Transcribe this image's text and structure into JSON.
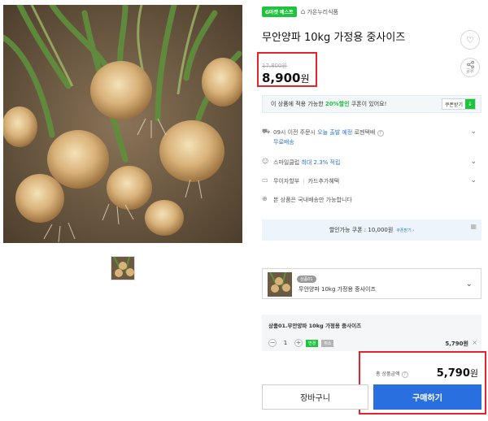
{
  "badges": {
    "seller_badge": "G마켓 베스트",
    "seller_name": "가온누리식품"
  },
  "product": {
    "title": "무안양파 10kg 가정용 중사이즈",
    "original_price": "17,800원",
    "price_number": "8,900",
    "price_unit": "원"
  },
  "actions": {
    "share_label": "공유"
  },
  "coupon_bar": {
    "text_before": "이 상품에 적용 가능한 ",
    "highlight": "20%할인",
    "text_after": " 쿠폰이 있어요!",
    "button_label": "쿠폰받기"
  },
  "info": {
    "delivery_time": "09시 이전 주문시",
    "delivery_highlight": "오늘 출발 예정",
    "delivery_extra": "로젠택배",
    "free_shipping": "무료배송",
    "smile_prefix": "스마일클럽",
    "smile_highlight": "최대 2.3% 적립",
    "installment": "무이자할부",
    "card_benefit": "카드추가혜택",
    "domestic": "본 상품은 국내배송만 가능합니다"
  },
  "discount": {
    "text": "할인가능 쿠폰 : 10,000원",
    "link": "쿠폰받기 ›"
  },
  "option": {
    "tag": "상품01",
    "name": "무안양파 10kg 가정용 중사이즈"
  },
  "selected": {
    "name": "상품01.무안양파 10kg 가정용 중사이즈",
    "quantity": "1",
    "tag_green": "변경",
    "tag_gray": "취소",
    "price": "5,790원"
  },
  "total": {
    "label": "총 상품금액",
    "price_number": "5,790",
    "price_unit": "원"
  },
  "buttons": {
    "cart": "장바구니",
    "buy": "구매하기"
  },
  "colors": {
    "accent_blue": "#2a6fe0",
    "accent_green": "#1ec43d",
    "highlight_red": "#e3242b"
  },
  "icons": [
    "heart-icon",
    "share-icon",
    "truck-icon",
    "smile-icon",
    "card-icon",
    "globe-icon",
    "chevron-down-icon",
    "download-icon",
    "home-icon"
  ]
}
